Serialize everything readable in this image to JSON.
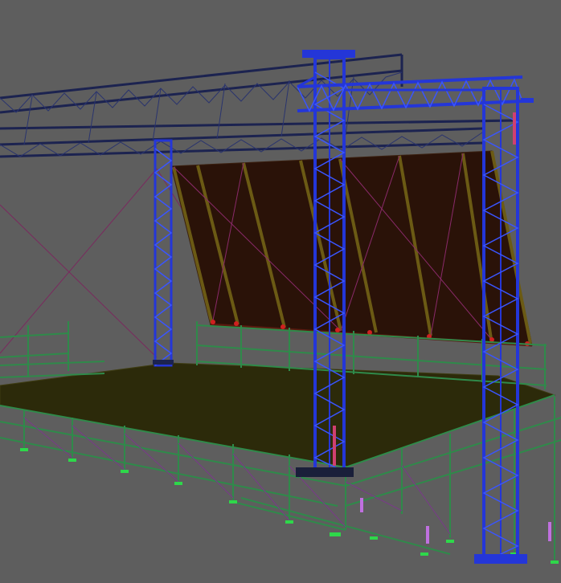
{
  "scene": {
    "colors": {
      "background": "#5e5e5e",
      "truss_dark": "#1c2350",
      "truss_blue": "#2436d8",
      "truss_blue_light": "#3a55ff",
      "scaffold": "#2f8a4a",
      "scaffold_light": "#58c27a",
      "roof_panel": "#2a1208",
      "roof_rib": "#6b5a14",
      "deck": "#2c2a0a",
      "brace_magenta": "#8a2a6a",
      "pad_green": "#2ed84a",
      "accent_red": "#d02020"
    }
  }
}
